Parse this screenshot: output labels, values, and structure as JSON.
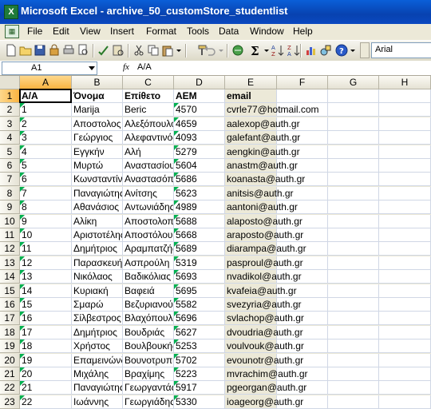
{
  "window": {
    "title": "Microsoft Excel - archive_50_customStore_studentlist",
    "app_icon_label": "X"
  },
  "menu": {
    "items": [
      "File",
      "Edit",
      "View",
      "Insert",
      "Format",
      "Tools",
      "Data",
      "Window",
      "Help"
    ]
  },
  "toolbar": {
    "font_name": "Arial"
  },
  "formula_bar": {
    "name_box": "A1",
    "fx_label": "fx",
    "content": "A/A"
  },
  "columns": [
    "A",
    "B",
    "C",
    "D",
    "E",
    "F",
    "G",
    "H"
  ],
  "rows": [
    [
      "A/A",
      "Όνομα",
      "Επίθετο",
      "ΑΕΜ",
      "email"
    ],
    [
      "1",
      "Marija",
      "Beric",
      "4570",
      "cvrle77@hotmail.com"
    ],
    [
      "2",
      "Αποστολος",
      "Αλεξόπουλος",
      "4659",
      "aalexop@auth.gr"
    ],
    [
      "3",
      " Γεώργιος",
      "Αλεφαντινός",
      "4093",
      "galefant@auth.gr"
    ],
    [
      "4",
      "Εγγκήν",
      "Αλή",
      "5279",
      "aengkin@auth.gr"
    ],
    [
      "5",
      "Μυρτώ",
      "Αναστασίου",
      "5604",
      "anastm@auth.gr"
    ],
    [
      "6",
      "Κωνσταντίνος",
      "Αναστασόπουλος",
      "5686",
      "koanasta@auth.gr"
    ],
    [
      "7",
      "Παναγιώτης",
      "Ανίτσης",
      "5623",
      "anitsis@auth.gr"
    ],
    [
      "8",
      "Αθανάσιος",
      "Αντωνιάδης",
      "4989",
      "aantoni@auth.gr"
    ],
    [
      "9",
      "Αλίκη",
      "Αποστολοπούλου",
      "5688",
      "alaposto@auth.gr"
    ],
    [
      "10",
      "Αριστοτέλης",
      "Αποστόλου",
      "5668",
      "araposto@auth.gr"
    ],
    [
      "11",
      "Δημήτριος",
      "Αραμπατζής",
      "5689",
      "diarampa@auth.gr"
    ],
    [
      "12",
      "Παρασκευή",
      "Ασπρούλη",
      "5319",
      "pasproul@auth.gr"
    ],
    [
      "13",
      "Νικόλαος",
      "Βαδικόλιας",
      "5693",
      "nvadikol@auth.gr"
    ],
    [
      "14",
      "Κυριακή",
      "Βαφειά",
      "5695",
      "kvafeia@auth.gr"
    ],
    [
      "15",
      "Σμαρώ",
      "Βεζυριανού",
      "5582",
      "svezyria@auth.gr"
    ],
    [
      "16",
      "Σίλβεστρος",
      "Βλαχόπουλος",
      "5696",
      "svlachop@auth.gr"
    ],
    [
      "17",
      "Δημήτριος",
      "Βουδριάς",
      "5627",
      "dvoudria@auth.gr"
    ],
    [
      "18",
      "Χρήστος",
      "Βουλβουκής",
      "5253",
      "voulvouk@auth.gr"
    ],
    [
      "19",
      "Επαμεινώνδας",
      "Βουνοτρυπίδης",
      "5702",
      "evounotr@auth.gr"
    ],
    [
      "20",
      "Μιχάλης",
      "Βραχίμης",
      "5223",
      "mvrachim@auth.gr"
    ],
    [
      "21",
      "Παναγιώτης",
      "Γεωργαντάς",
      "5917",
      "pgeorgan@auth.gr"
    ],
    [
      "22",
      "Ιωάννης",
      "Γεωργιάδης",
      "5330",
      "ioageorg@auth.gr"
    ]
  ],
  "row_numbers": [
    "1",
    "2",
    "3",
    "4",
    "5",
    "6",
    "7",
    "8",
    "9",
    "10",
    "11",
    "12",
    "13",
    "14",
    "15",
    "16",
    "17",
    "18",
    "19",
    "20",
    "21",
    "22",
    "23"
  ]
}
